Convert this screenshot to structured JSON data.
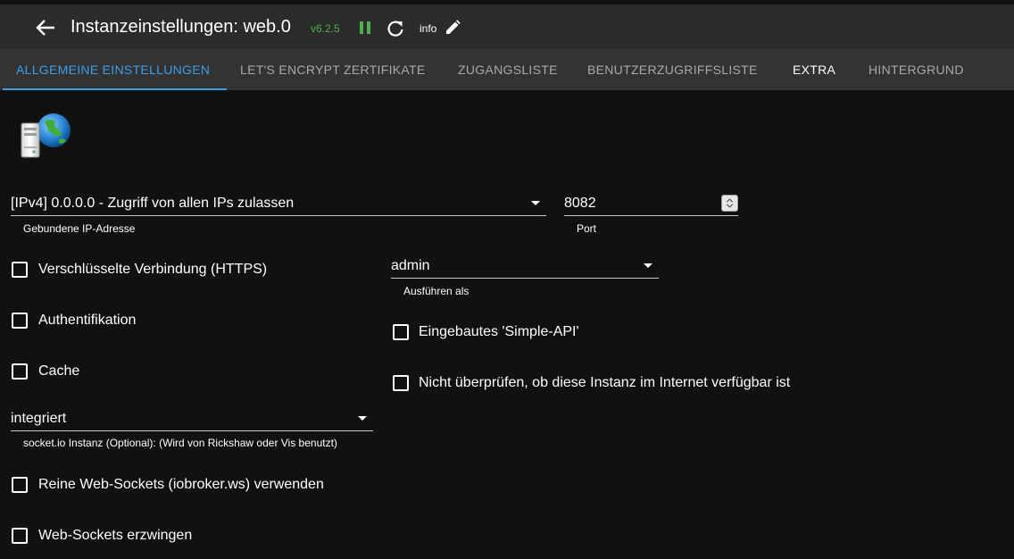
{
  "header": {
    "title": "Instanzeinstellungen: web.0",
    "version": "v6.2.5",
    "info_label": "info",
    "icons": [
      "arrow-back-icon",
      "pause-icon",
      "reload-icon",
      "pencil-icon"
    ]
  },
  "tabs": [
    {
      "label": "ALLGEMEINE EINSTELLUNGEN",
      "active": true
    },
    {
      "label": "LET'S ENCRYPT ZERTIFIKATE"
    },
    {
      "label": "ZUGANGSLISTE"
    },
    {
      "label": "BENUTZERZUGRIFFSLISTE"
    },
    {
      "label": "EXTRA"
    },
    {
      "label": "HINTERGRUND"
    }
  ],
  "form": {
    "bind_select": {
      "value": "[IPv4] 0.0.0.0 - Zugriff von allen IPs zulassen",
      "helper": "Gebundene IP-Adresse"
    },
    "port": {
      "value": "8082",
      "helper": "Port"
    },
    "https": {
      "label": "Verschlüsselte Verbindung (HTTPS)",
      "checked": false
    },
    "run_as": {
      "value": "admin",
      "helper": "Ausführen als"
    },
    "auth": {
      "label": "Authentifikation",
      "checked": false
    },
    "simple_api": {
      "label": "Eingebautes 'Simple-API'",
      "checked": false
    },
    "cache": {
      "label": "Cache",
      "checked": false
    },
    "no_check": {
      "label": "Nicht überprüfen, ob diese Instanz im Internet verfügbar ist",
      "checked": false
    },
    "socketio": {
      "value": "integriert",
      "helper": "socket.io Instanz (Optional): (Wird von Rickshaw oder Vis benutzt)"
    },
    "pure_ws": {
      "label": "Reine Web-Sockets (iobroker.ws) verwenden",
      "checked": false
    },
    "force_ws": {
      "label": "Web-Sockets erzwingen",
      "checked": false
    }
  },
  "colors": {
    "accent": "#3d9ee9",
    "version_green": "#4caf50",
    "background": "#111111",
    "header": "#2b2b2b",
    "tabbar": "#333333"
  }
}
